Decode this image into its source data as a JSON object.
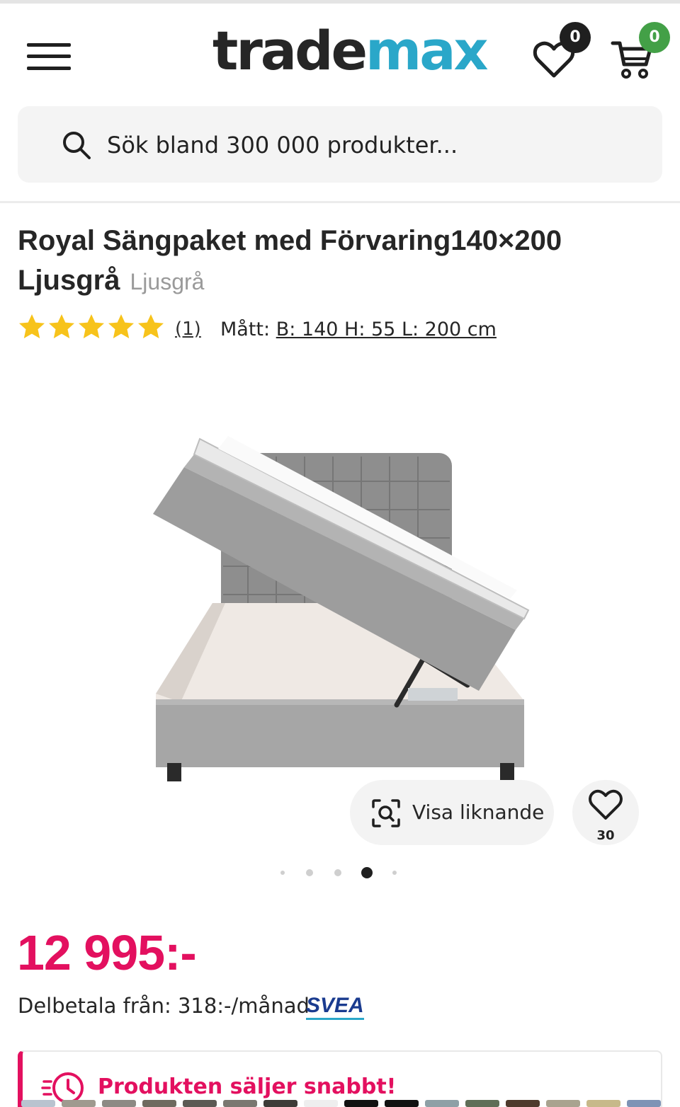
{
  "header": {
    "logo_part1": "trade",
    "logo_part2": "max",
    "wishlist_count": "0",
    "cart_count": "0"
  },
  "search": {
    "placeholder": "Sök bland 300 000 produkter..."
  },
  "product": {
    "title": "Royal Sängpaket med Förvaring140×200 Ljusgrå",
    "variant": "Ljusgrå",
    "rating_stars": 5,
    "review_count": "(1)",
    "dims_label": "Mått: ",
    "dims_value": "B: 140 H: 55 L: 200 cm",
    "similar_label": "Visa liknande",
    "favorite_count": "30",
    "image_count": 5,
    "active_image_index": 3,
    "price": "12 995:-",
    "installment": "Delbetala från: 318:-/månad",
    "financing_brand": "SVEA",
    "urgency_message": "Produkten säljer snabbt!"
  },
  "colors": {
    "brand_dark": "#262626",
    "brand_accent": "#2aa7c9",
    "price": "#e3105f",
    "star": "#f7c31b",
    "cart_badge": "#43a047"
  },
  "icons": [
    "menu-icon",
    "heart-icon",
    "cart-icon",
    "search-icon",
    "star-icon",
    "visual-search-icon",
    "clock-icon"
  ]
}
